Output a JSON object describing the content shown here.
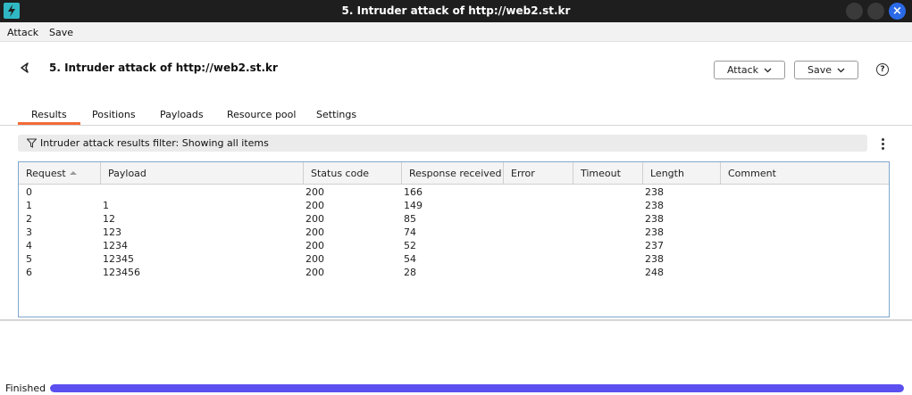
{
  "window": {
    "title": "5. Intruder attack of http://web2.st.kr"
  },
  "menu": {
    "items": [
      "Attack",
      "Save"
    ]
  },
  "header": {
    "title": "5. Intruder attack of http://web2.st.kr",
    "attack_button": "Attack",
    "save_button": "Save",
    "help_glyph": "?"
  },
  "tabs": [
    "Results",
    "Positions",
    "Payloads",
    "Resource pool",
    "Settings"
  ],
  "active_tab": "Results",
  "filter": {
    "text": "Intruder attack results filter: Showing all items"
  },
  "table": {
    "columns": [
      "Request",
      "Payload",
      "Status code",
      "Response received",
      "Error",
      "Timeout",
      "Length",
      "Comment"
    ],
    "sorted_column": "Request",
    "rows": [
      {
        "request": "0",
        "payload": "",
        "status": "200",
        "received": "166",
        "error": "",
        "timeout": "",
        "length": "238",
        "comment": ""
      },
      {
        "request": "1",
        "payload": "1",
        "status": "200",
        "received": "149",
        "error": "",
        "timeout": "",
        "length": "238",
        "comment": ""
      },
      {
        "request": "2",
        "payload": "12",
        "status": "200",
        "received": "85",
        "error": "",
        "timeout": "",
        "length": "238",
        "comment": ""
      },
      {
        "request": "3",
        "payload": "123",
        "status": "200",
        "received": "74",
        "error": "",
        "timeout": "",
        "length": "238",
        "comment": ""
      },
      {
        "request": "4",
        "payload": "1234",
        "status": "200",
        "received": "52",
        "error": "",
        "timeout": "",
        "length": "237",
        "comment": ""
      },
      {
        "request": "5",
        "payload": "12345",
        "status": "200",
        "received": "54",
        "error": "",
        "timeout": "",
        "length": "238",
        "comment": ""
      },
      {
        "request": "6",
        "payload": "123456",
        "status": "200",
        "received": "28",
        "error": "",
        "timeout": "",
        "length": "248",
        "comment": ""
      }
    ]
  },
  "status": {
    "label": "Finished",
    "progress_fraction": 1.0
  },
  "colors": {
    "titlebar": "#1e1e1e",
    "active_tab_underline": "#f26b38",
    "progress_fill": "#5b4ff0",
    "table_border": "#7fa7cf",
    "close_button": "#2a6ae8",
    "app_icon": "#2fb8c4"
  },
  "icons": [
    "app-logo-icon",
    "minimize-icon",
    "maximize-icon",
    "close-icon",
    "back-icon",
    "chevron-down-icon",
    "help-icon",
    "filter-icon",
    "kebab-menu-icon",
    "sort-ascending-icon"
  ]
}
